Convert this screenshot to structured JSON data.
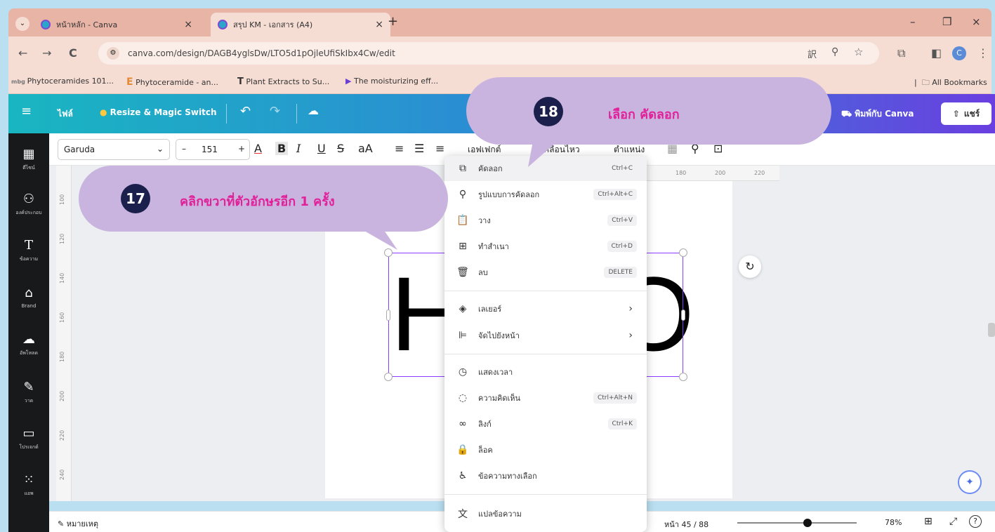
{
  "browser": {
    "tabs": [
      {
        "title": "หน้าหลัก - Canva",
        "close": "×"
      },
      {
        "title": "สรุป KM - เอกสาร (A4)",
        "close": "×"
      }
    ],
    "new_tab": "+",
    "window_controls": {
      "minimize": "–",
      "restore": "❐",
      "close": "×"
    },
    "url": "canva.com/design/DAGB4yglsDw/LTO5d1pOjleUfiSkIbx4Cw/edit",
    "bookmarks": [
      "Phytoceramides 101...",
      "Phytoceramide - an...",
      "Plant Extracts to Su...",
      "The moisturizing eff..."
    ],
    "all_bookmarks": "All Bookmarks",
    "profile_initial": "C"
  },
  "canva_header": {
    "file_label": "ไฟล์",
    "resize_label": "Resize & Magic Switch",
    "print_label": "พิมพ์กับ Canva",
    "share_label": "แชร์"
  },
  "sidebar": {
    "items": [
      {
        "icon": "template-icon",
        "label": "ดีไซน์"
      },
      {
        "icon": "elements-icon",
        "label": "องค์ประกอบ"
      },
      {
        "icon": "text-icon",
        "label": "ข้อความ"
      },
      {
        "icon": "brand-icon",
        "label": "Brand"
      },
      {
        "icon": "upload-icon",
        "label": "อัพโหลด"
      },
      {
        "icon": "draw-icon",
        "label": "วาด"
      },
      {
        "icon": "folder-icon",
        "label": "โปรเจกต์"
      },
      {
        "icon": "apps-icon",
        "label": "แอพ"
      }
    ]
  },
  "toolbar": {
    "font": "Garuda",
    "font_size": "151",
    "minus": "–",
    "plus": "+",
    "effects": "เอฟเฟกต์",
    "animate": "เคลื่อนไหว",
    "position": "ตำแหน่ง"
  },
  "rulers": {
    "vertical": [
      "100",
      "120",
      "140",
      "160",
      "180",
      "200",
      "220",
      "240"
    ],
    "horizontal": [
      "180",
      "200",
      "220"
    ]
  },
  "canvas": {
    "text_left": "H",
    "text_right": "O"
  },
  "context_menu": {
    "items": [
      {
        "icon": "copy-icon",
        "label": "คัดลอก",
        "shortcut": "Ctrl+C"
      },
      {
        "icon": "paint-format-icon",
        "label": "รูปแบบการคัดลอก",
        "shortcut": "Ctrl+Alt+C"
      },
      {
        "icon": "paste-icon",
        "label": "วาง",
        "shortcut": "Ctrl+V"
      },
      {
        "icon": "duplicate-icon",
        "label": "ทำสำเนา",
        "shortcut": "Ctrl+D"
      },
      {
        "icon": "trash-icon",
        "label": "ลบ",
        "shortcut": "DELETE"
      },
      {
        "icon": "layers-icon",
        "label": "เลเยอร์",
        "shortcut": ""
      },
      {
        "icon": "align-icon",
        "label": "จัดไปยังหน้า",
        "shortcut": ""
      },
      {
        "icon": "clock-icon",
        "label": "แสดงเวลา",
        "shortcut": ""
      },
      {
        "icon": "comment-icon",
        "label": "ความคิดเห็น",
        "shortcut": "Ctrl+Alt+N"
      },
      {
        "icon": "link-icon",
        "label": "ลิงก์",
        "shortcut": "Ctrl+K"
      },
      {
        "icon": "lock-icon",
        "label": "ล็อค",
        "shortcut": ""
      },
      {
        "icon": "accessibility-icon",
        "label": "ข้อความทางเลือก",
        "shortcut": ""
      },
      {
        "icon": "translate-icon",
        "label": "แปลข้อความ",
        "shortcut": ""
      }
    ]
  },
  "bottom_bar": {
    "notes": "หมายเหตุ",
    "page_indicator": "หน้า 45 / 88",
    "zoom": "78%"
  },
  "callouts": [
    {
      "number": "17",
      "text": "คลิกขวาที่ตัวอักษรอีก 1 ครั้ง"
    },
    {
      "number": "18",
      "text": "เลือก คัดลอก"
    }
  ],
  "colors": {
    "callout_bg": "#c8b4de",
    "callout_text": "#e0219a",
    "badge": "#1b1f4b",
    "selection": "#8b3dff"
  }
}
